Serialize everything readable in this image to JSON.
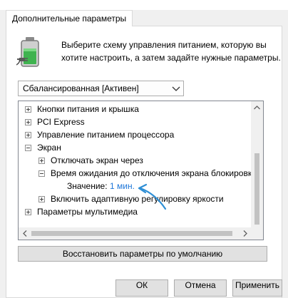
{
  "tab": {
    "label": "Дополнительные параметры"
  },
  "description": {
    "line1": "Выберите схему управления питанием, которую вы",
    "line2": "хотите настроить, а затем задайте нужные параметры."
  },
  "plan_select": {
    "value": "Сбалансированная [Активен]"
  },
  "tree": {
    "items": [
      {
        "label": "Кнопки питания и крышка",
        "state": "collapsed"
      },
      {
        "label": "PCI Express",
        "state": "collapsed"
      },
      {
        "label": "Управление питанием процессора",
        "state": "collapsed"
      },
      {
        "label": "Экран",
        "state": "expanded"
      },
      {
        "label": "Отключать экран через",
        "state": "collapsed"
      },
      {
        "label": "Время ожидания до отключения экрана блокировки",
        "state": "expanded"
      },
      {
        "label": "Значение:",
        "value": "1 мин."
      },
      {
        "label": "Включить адаптивную регулировку яркости",
        "state": "collapsed"
      },
      {
        "label": "Параметры мультимедиа",
        "state": "collapsed"
      }
    ]
  },
  "restore_button": {
    "label": "Восстановить параметры по умолчанию"
  },
  "bottom_buttons": {
    "ok": "ОК",
    "cancel": "Отмена",
    "apply": "Применить"
  },
  "colors": {
    "accent": "#1f77d9",
    "arrow": "#2f8fd5",
    "battery": "#3fb34f"
  },
  "icons": {
    "battery": "battery-charging-icon",
    "combo_arrow": "chevron-down-icon",
    "scroll_up": "arrow-up-icon",
    "scroll_down": "arrow-down-icon",
    "scroll_left": "arrow-left-icon",
    "scroll_right": "arrow-right-icon"
  }
}
